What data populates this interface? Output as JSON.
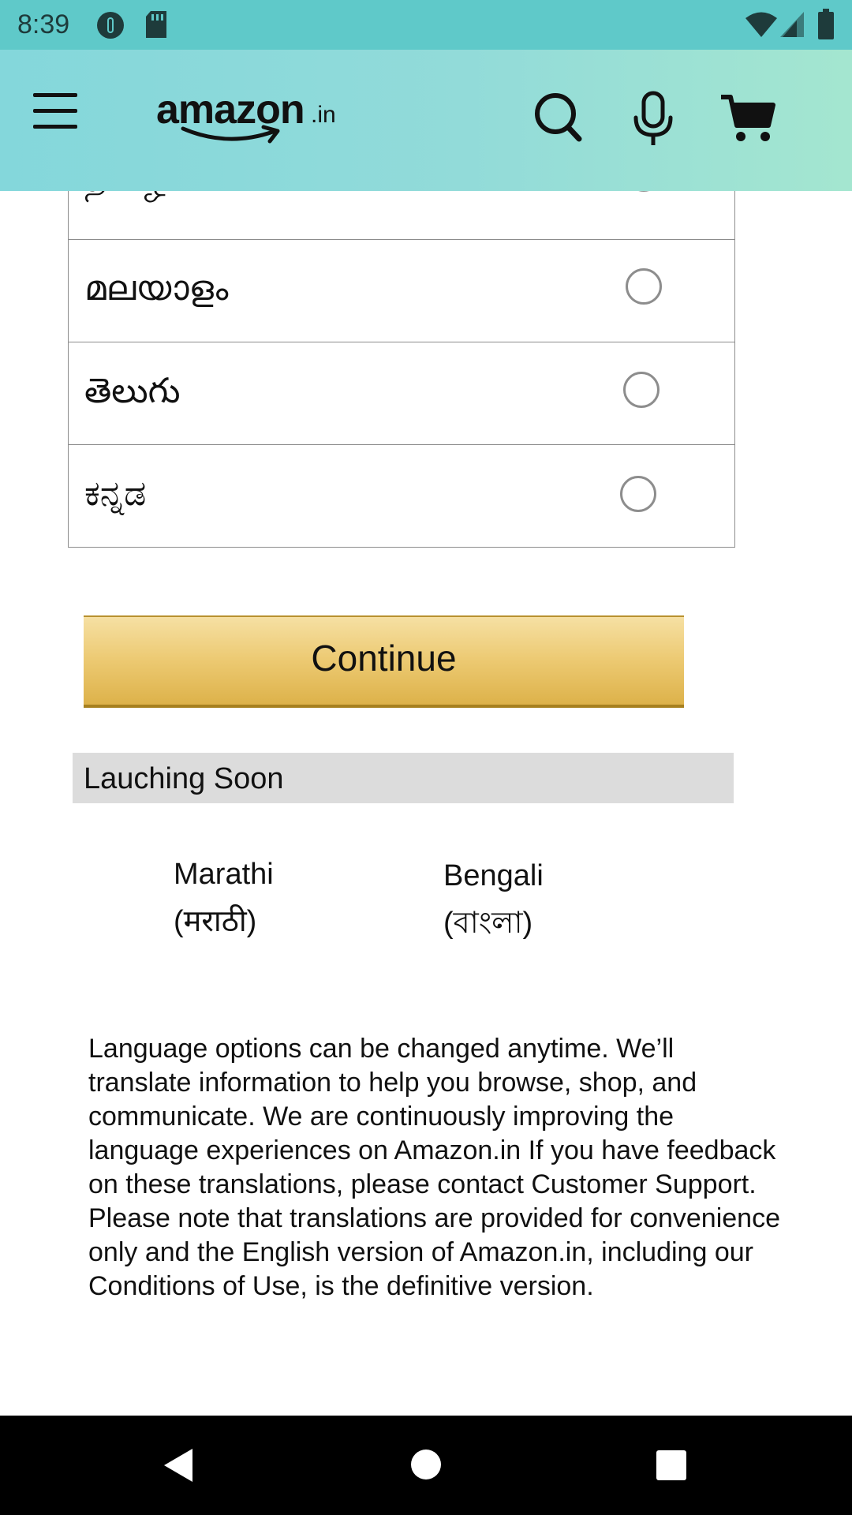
{
  "status_bar": {
    "time": "8:39"
  },
  "header": {
    "logo_text": "amazon",
    "logo_suffix": ".in"
  },
  "languages": [
    {
      "name": "தமிழ்"
    },
    {
      "name": "മലയാളം"
    },
    {
      "name": "తెలుగు"
    },
    {
      "name": "ಕನ್ನಡ"
    }
  ],
  "continue_label": "Continue",
  "launching_soon": {
    "label": "Lauching Soon",
    "items": [
      {
        "name": "Marathi",
        "native": "(मराठी)"
      },
      {
        "name": "Bengali",
        "native": "(বাংলা)"
      }
    ]
  },
  "note": "Language options can be changed anytime. We’ll translate information to help you browse, shop, and communicate. We are continuously improving the language experiences on Amazon.in If you have feedback on these translations, please contact Customer Support. Please note that translations are provided for convenience only and the English version of Amazon.in, including our Conditions of Use, is the definitive version.",
  "colors": {
    "status_bar": "#5fc9c9",
    "header_start": "#84d7db",
    "header_end": "#a4e6d0",
    "button_top": "#f6e0a3",
    "button_bottom": "#ddb24a",
    "soon_bar": "#dcdcdc"
  },
  "icons": {
    "status_left": [
      "data-saver-icon",
      "sd-card-icon"
    ],
    "status_right": [
      "wifi-icon",
      "cell-signal-icon",
      "battery-icon"
    ],
    "header": [
      "menu-icon",
      "search-icon",
      "microphone-icon",
      "cart-icon"
    ],
    "nav": [
      "back-icon",
      "home-icon",
      "recents-icon"
    ]
  }
}
